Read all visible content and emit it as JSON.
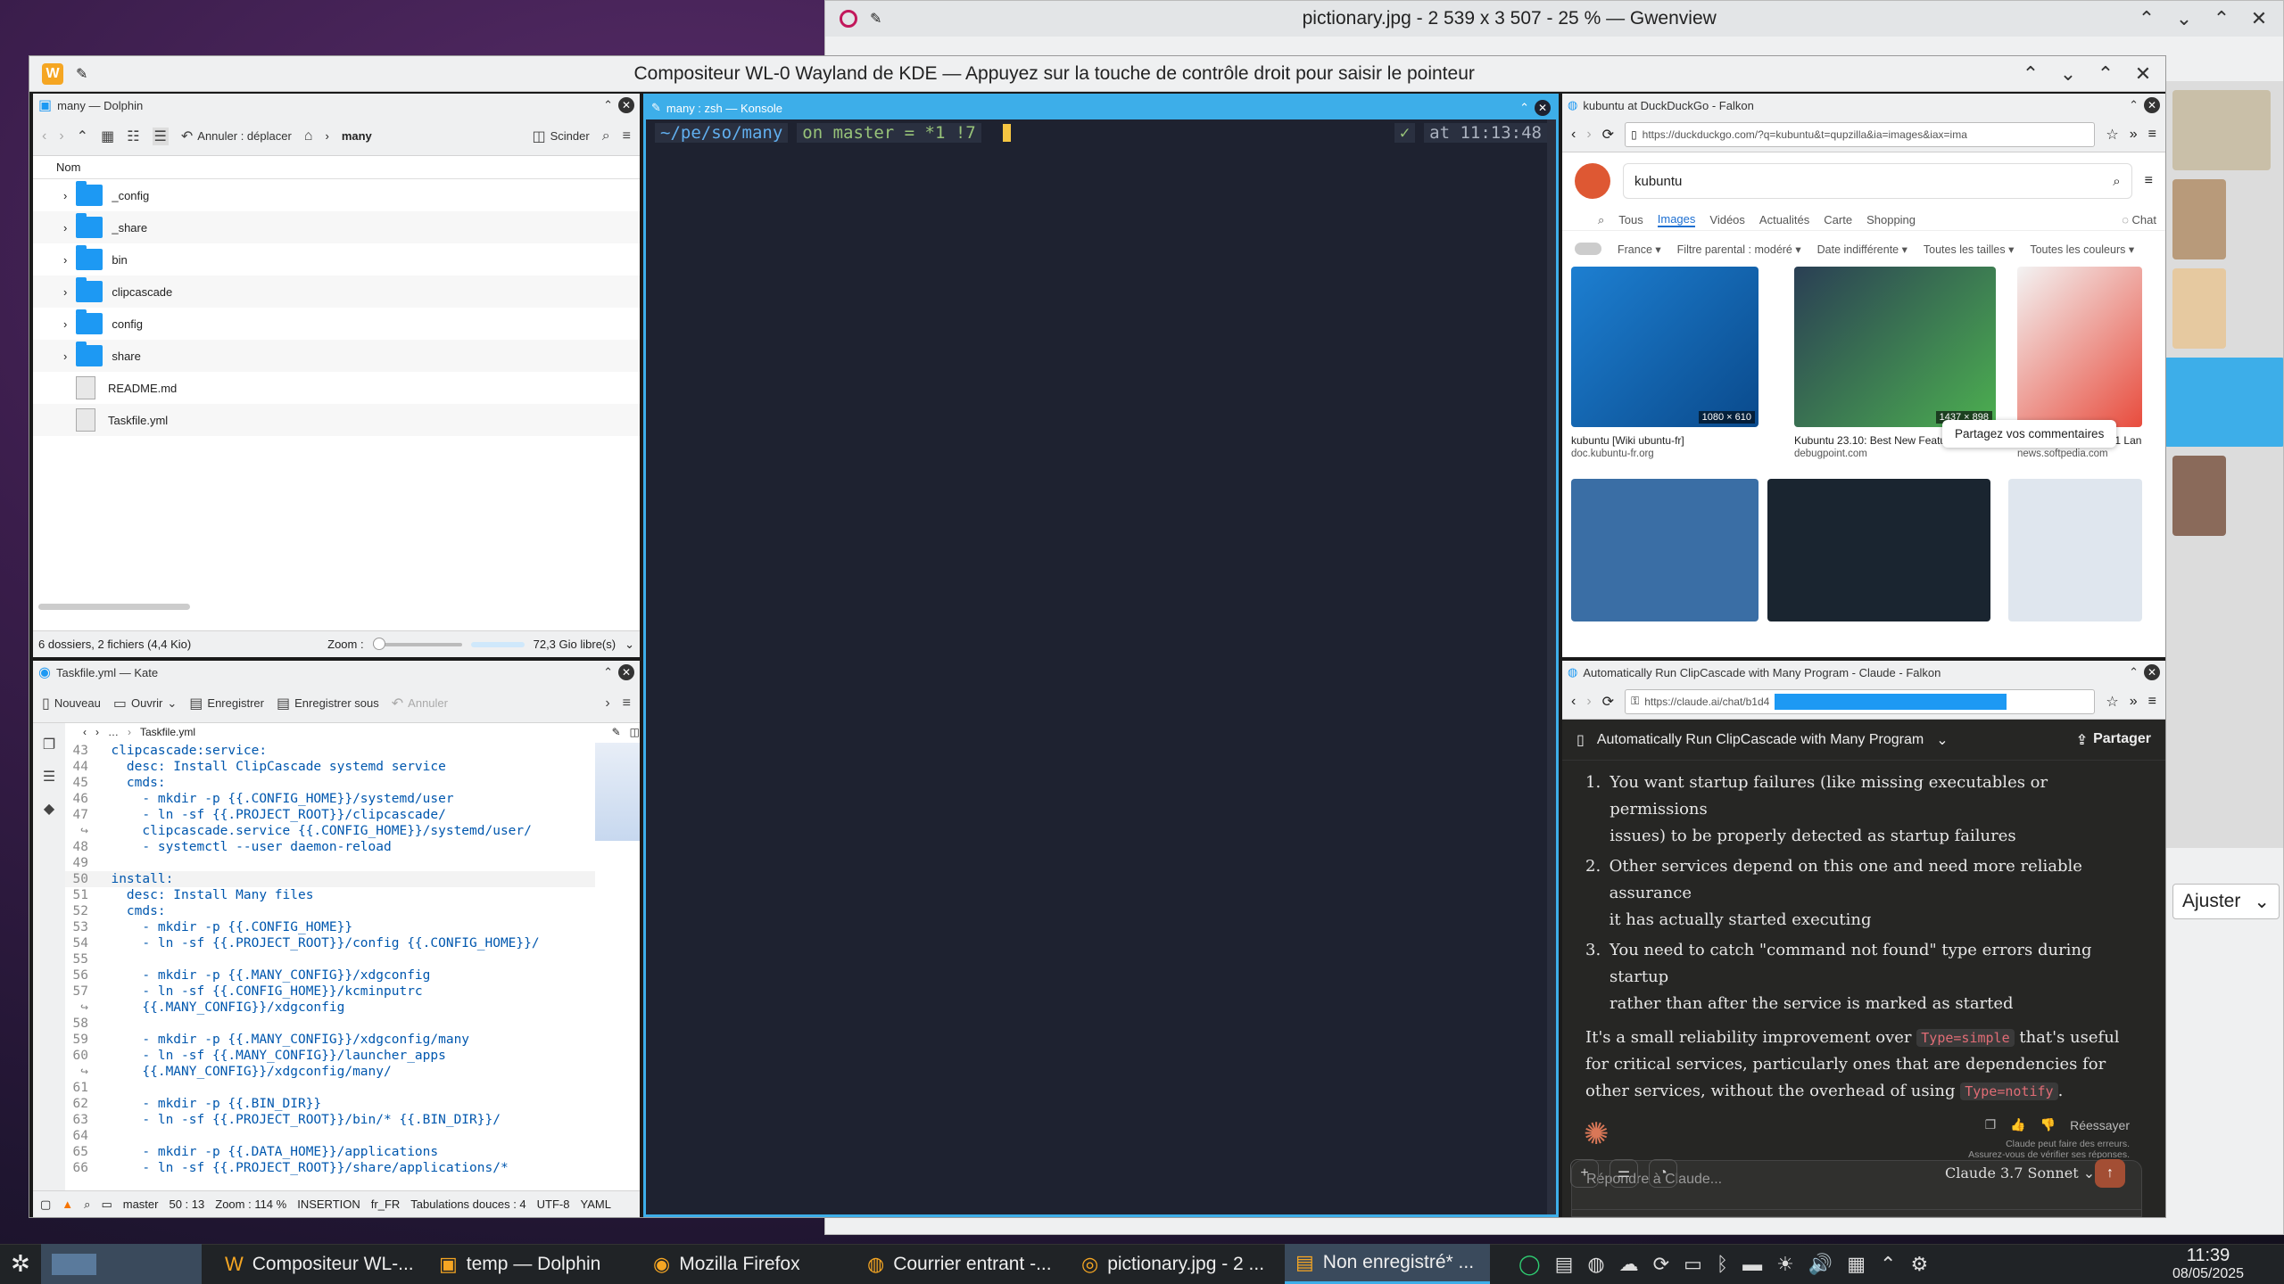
{
  "colors": {
    "accent": "#1d99f3",
    "konsole_bg": "#1e2230",
    "claude_bg": "#262624",
    "claude_accent": "#d97757"
  },
  "gwenview": {
    "title": "pictionary.jpg - 2 539 x 3 507 - 25 % — Gwenview",
    "zoom_mode": "Ajuster"
  },
  "compositor": {
    "title": "Compositeur WL-0 Wayland de KDE — Appuyez sur la touche de contrôle droit pour saisir le pointeur"
  },
  "dolphin": {
    "title": "many — Dolphin",
    "undo_label": "Annuler : déplacer",
    "breadcrumb": "many",
    "split_label": "Scinder",
    "column_name": "Nom",
    "items": [
      {
        "name": "_config",
        "type": "folder"
      },
      {
        "name": "_share",
        "type": "folder"
      },
      {
        "name": "bin",
        "type": "folder"
      },
      {
        "name": "clipcascade",
        "type": "folder"
      },
      {
        "name": "config",
        "type": "folder"
      },
      {
        "name": "share",
        "type": "folder"
      },
      {
        "name": "README.md",
        "type": "file"
      },
      {
        "name": "Taskfile.yml",
        "type": "file"
      }
    ],
    "status": "6 dossiers, 2 fichiers (4,4 Kio)",
    "zoom_label": "Zoom :",
    "free_space": "72,3 Gio libre(s)"
  },
  "konsole": {
    "title": "many : zsh — Konsole",
    "path": "~/pe/so/many",
    "git": "on master = *1 !7",
    "check": "✓",
    "time": "at 11:13:48"
  },
  "kate": {
    "title": "Taskfile.yml — Kate",
    "new": "Nouveau",
    "open": "Ouvrir",
    "save": "Enregistrer",
    "save_as": "Enregistrer sous",
    "undo": "Annuler",
    "tab": "Taskfile.yml",
    "lines": [
      {
        "n": "43",
        "t": "  clipcascade:service:"
      },
      {
        "n": "44",
        "t": "    desc: Install ClipCascade systemd service"
      },
      {
        "n": "45",
        "t": "    cmds:"
      },
      {
        "n": "46",
        "t": "      - mkdir -p {{.CONFIG_HOME}}/systemd/user"
      },
      {
        "n": "47",
        "t": "      - ln -sf {{.PROJECT_ROOT}}/clipcascade/"
      },
      {
        "n": "↪",
        "t": "      clipcascade.service {{.CONFIG_HOME}}/systemd/user/"
      },
      {
        "n": "48",
        "t": "      - systemctl --user daemon-reload"
      },
      {
        "n": "49",
        "t": ""
      },
      {
        "n": "50",
        "t": "  install:"
      },
      {
        "n": "51",
        "t": "    desc: Install Many files"
      },
      {
        "n": "52",
        "t": "    cmds:"
      },
      {
        "n": "53",
        "t": "      - mkdir -p {{.CONFIG_HOME}}"
      },
      {
        "n": "54",
        "t": "      - ln -sf {{.PROJECT_ROOT}}/config {{.CONFIG_HOME}}/"
      },
      {
        "n": "55",
        "t": ""
      },
      {
        "n": "56",
        "t": "      - mkdir -p {{.MANY_CONFIG}}/xdgconfig"
      },
      {
        "n": "57",
        "t": "      - ln -sf {{.CONFIG_HOME}}/kcminputrc"
      },
      {
        "n": "↪",
        "t": "      {{.MANY_CONFIG}}/xdgconfig"
      },
      {
        "n": "58",
        "t": ""
      },
      {
        "n": "59",
        "t": "      - mkdir -p {{.MANY_CONFIG}}/xdgconfig/many"
      },
      {
        "n": "60",
        "t": "      - ln -sf {{.MANY_CONFIG}}/launcher_apps"
      },
      {
        "n": "↪",
        "t": "      {{.MANY_CONFIG}}/xdgconfig/many/"
      },
      {
        "n": "61",
        "t": ""
      },
      {
        "n": "62",
        "t": "      - mkdir -p {{.BIN_DIR}}"
      },
      {
        "n": "63",
        "t": "      - ln -sf {{.PROJECT_ROOT}}/bin/* {{.BIN_DIR}}/"
      },
      {
        "n": "64",
        "t": ""
      },
      {
        "n": "65",
        "t": "      - mkdir -p {{.DATA_HOME}}/applications"
      },
      {
        "n": "66",
        "t": "      - ln -sf {{.PROJECT_ROOT}}/share/applications/*"
      }
    ],
    "status": {
      "branch": "master",
      "pos": "50 : 13",
      "zoom": "Zoom : 114 %",
      "mode": "INSERTION",
      "lang": "fr_FR",
      "indent": "Tabulations douces : 4",
      "enc": "UTF-8",
      "syntax": "YAML"
    }
  },
  "falkon1": {
    "title": "kubuntu at DuckDuckGo - Falkon",
    "url": "https://duckduckgo.com/?q=kubuntu&t=qupzilla&ia=images&iax=ima",
    "query": "kubuntu",
    "tabs": [
      "Tous",
      "Images",
      "Vidéos",
      "Actualités",
      "Carte",
      "Shopping"
    ],
    "chat": "Chat",
    "filters": [
      "France",
      "Filtre parental : modéré",
      "Date indifférente",
      "Toutes les tailles",
      "Toutes les couleurs"
    ],
    "results": [
      {
        "title": "kubuntu [Wiki ubuntu-fr]",
        "source": "doc.kubuntu-fr.org",
        "size": "1080 × 610"
      },
      {
        "title": "Kubuntu 23.10: Best New Features",
        "source": "debugpoint.com",
        "size": "1437 × 898"
      },
      {
        "title": "Kubuntu 15.10 Beta 1 Lan",
        "source": "news.softpedia.com",
        "size": ""
      }
    ],
    "feedback": "Partagez vos commentaires"
  },
  "falkon2": {
    "title": "Automatically Run ClipCascade with Many Program - Claude - Falkon",
    "url": "https://claude.ai/chat/b1d4",
    "chat_title": "Automatically Run ClipCascade with Many Program",
    "share": "Partager",
    "list": [
      {
        "n": "1.",
        "a": "You want startup failures (like missing executables or permissions",
        "b": "issues) to be properly detected as startup failures"
      },
      {
        "n": "2.",
        "a": "Other services depend on this one and need more reliable assurance",
        "b": "it has actually started executing"
      },
      {
        "n": "3.",
        "a": "You need to catch \"command not found\" type errors during startup",
        "b": "rather than after the service is marked as started"
      }
    ],
    "para1": "It's a small reliability improvement over",
    "code1": "Type=simple",
    "para2": "that's useful for",
    "para3": "critical services, particularly ones that are dependencies for other",
    "para4": "services, without the overhead of using",
    "code2": "Type=notify",
    "para5": ".",
    "retry": "Réessayer",
    "disclaimer": "Claude peut faire des erreurs.",
    "disclaimer2": "Assurez-vous de vérifier ses réponses.",
    "input_placeholder": "Répondre à Claude...",
    "model": "Claude 3.7 Sonnet"
  },
  "taskbar": {
    "items": [
      "Compositeur WL-...",
      "temp — Dolphin",
      "Mozilla Firefox",
      "Courrier entrant -...",
      "pictionary.jpg - 2 ...",
      "Non enregistré* ..."
    ],
    "time": "11:39",
    "date": "08/05/2025"
  }
}
